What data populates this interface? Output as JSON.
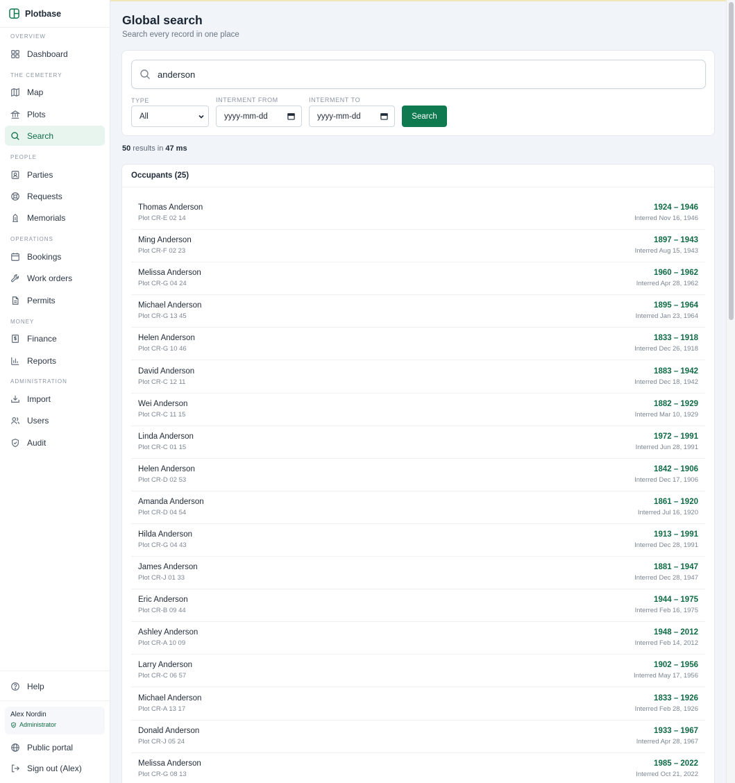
{
  "app": {
    "name": "Plotbase"
  },
  "sidebar": {
    "sections": {
      "overview": "OVERVIEW",
      "cemetery": "THE CEMETERY",
      "people": "PEOPLE",
      "operations": "OPERATIONS",
      "money": "MONEY",
      "administration": "ADMINISTRATION"
    },
    "items": {
      "dashboard": "Dashboard",
      "map": "Map",
      "plots": "Plots",
      "search": "Search",
      "parties": "Parties",
      "requests": "Requests",
      "memorials": "Memorials",
      "bookings": "Bookings",
      "work_orders": "Work orders",
      "permits": "Permits",
      "finance": "Finance",
      "reports": "Reports",
      "import": "Import",
      "users": "Users",
      "audit": "Audit"
    },
    "active": "search",
    "help": "Help",
    "user": {
      "name": "Alex Nordin",
      "role": "Administrator"
    },
    "public_portal": "Public portal",
    "sign_out": "Sign out (Alex)"
  },
  "page": {
    "title": "Global search",
    "subtitle": "Search every record in one place"
  },
  "search": {
    "query": "anderson",
    "type_label": "TYPE",
    "type_value": "All",
    "from_label": "INTERMENT FROM",
    "from_placeholder": "yyyy-mm-dd",
    "to_label": "INTERMENT TO",
    "to_placeholder": "yyyy-mm-dd",
    "button": "Search"
  },
  "summary": {
    "count": "50",
    "middle": " results in ",
    "time": "47 ms"
  },
  "occupants": {
    "heading": "Occupants (25)",
    "rows": [
      {
        "name": "Thomas Anderson",
        "plot": "Plot CR-E 02 14",
        "years": "1924 – 1946",
        "interred": "Interred Nov 16, 1946"
      },
      {
        "name": "Ming Anderson",
        "plot": "Plot CR-F 02 23",
        "years": "1897 – 1943",
        "interred": "Interred Aug 15, 1943"
      },
      {
        "name": "Melissa Anderson",
        "plot": "Plot CR-G 04 24",
        "years": "1960 – 1962",
        "interred": "Interred Apr 28, 1962"
      },
      {
        "name": "Michael Anderson",
        "plot": "Plot CR-G 13 45",
        "years": "1895 – 1964",
        "interred": "Interred Jan 23, 1964"
      },
      {
        "name": "Helen Anderson",
        "plot": "Plot CR-G 10 46",
        "years": "1833 – 1918",
        "interred": "Interred Dec 26, 1918"
      },
      {
        "name": "David Anderson",
        "plot": "Plot CR-C 12 11",
        "years": "1883 – 1942",
        "interred": "Interred Dec 18, 1942"
      },
      {
        "name": "Wei Anderson",
        "plot": "Plot CR-C 11 15",
        "years": "1882 – 1929",
        "interred": "Interred Mar 10, 1929"
      },
      {
        "name": "Linda Anderson",
        "plot": "Plot CR-C 01 15",
        "years": "1972 – 1991",
        "interred": "Interred Jun 28, 1991"
      },
      {
        "name": "Helen Anderson",
        "plot": "Plot CR-D 02 53",
        "years": "1842 – 1906",
        "interred": "Interred Dec 17, 1906"
      },
      {
        "name": "Amanda Anderson",
        "plot": "Plot CR-D 04 54",
        "years": "1861 – 1920",
        "interred": "Interred Jul 16, 1920"
      },
      {
        "name": "Hilda Anderson",
        "plot": "Plot CR-G 04 43",
        "years": "1913 – 1991",
        "interred": "Interred Dec 28, 1991"
      },
      {
        "name": "James Anderson",
        "plot": "Plot CR-J 01 33",
        "years": "1881 – 1947",
        "interred": "Interred Dec 28, 1947"
      },
      {
        "name": "Eric Anderson",
        "plot": "Plot CR-B 09 44",
        "years": "1944 – 1975",
        "interred": "Interred Feb 16, 1975"
      },
      {
        "name": "Ashley Anderson",
        "plot": "Plot CR-A 10 09",
        "years": "1948 – 2012",
        "interred": "Interred Feb 14, 2012"
      },
      {
        "name": "Larry Anderson",
        "plot": "Plot CR-C 06 57",
        "years": "1902 – 1956",
        "interred": "Interred May 17, 1956"
      },
      {
        "name": "Michael Anderson",
        "plot": "Plot CR-A 13 17",
        "years": "1833 – 1926",
        "interred": "Interred Feb 28, 1926"
      },
      {
        "name": "Donald Anderson",
        "plot": "Plot CR-J 05 24",
        "years": "1933 – 1967",
        "interred": "Interred Apr 28, 1967"
      },
      {
        "name": "Melissa Anderson",
        "plot": "Plot CR-G 08 13",
        "years": "1985 – 2022",
        "interred": "Interred Oct 21, 2022"
      }
    ]
  },
  "colors": {
    "accent": "#0f7a4f",
    "accent_text": "#0f6b46",
    "active_bg": "#e7f5ee",
    "page_bg": "#f1f4f8"
  }
}
